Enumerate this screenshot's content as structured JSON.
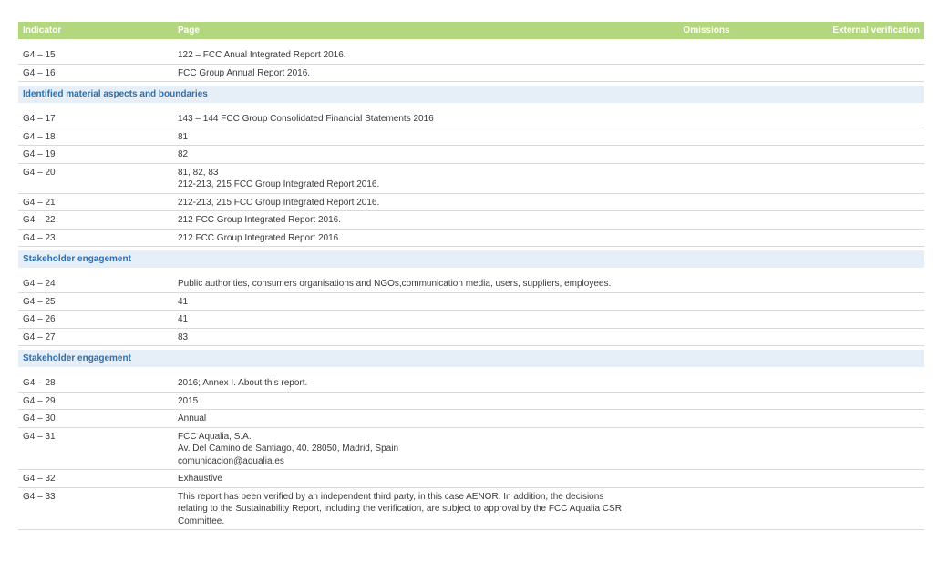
{
  "table": {
    "headers": {
      "indicator": "Indicator",
      "page": "Page",
      "omissions": "Omissions",
      "external_verification": "External verification"
    },
    "groups": [
      {
        "section": "",
        "rows": [
          {
            "indicator": "G4 – 15",
            "page": [
              "122 – FCC Anual Integrated Report 2016."
            ]
          },
          {
            "indicator": "G4 – 16",
            "page": [
              "FCC Group Annual Report 2016."
            ]
          }
        ]
      },
      {
        "section": "Identified material aspects and boundaries",
        "rows": [
          {
            "indicator": "G4 – 17",
            "page": [
              "143 – 144 FCC Group Consolidated Financial Statements 2016"
            ]
          },
          {
            "indicator": "G4 – 18",
            "page": [
              "81"
            ]
          },
          {
            "indicator": "G4 – 19",
            "page": [
              "82"
            ]
          },
          {
            "indicator": "G4 – 20",
            "page": [
              "81, 82, 83",
              "212-213, 215 FCC Group Integrated Report 2016."
            ]
          },
          {
            "indicator": "G4 – 21",
            "page": [
              "212-213, 215 FCC Group Integrated Report 2016."
            ]
          },
          {
            "indicator": "G4 – 22",
            "page": [
              "212 FCC Group Integrated Report 2016."
            ]
          },
          {
            "indicator": "G4 – 23",
            "page": [
              "212 FCC Group Integrated Report 2016."
            ]
          }
        ]
      },
      {
        "section": "Stakeholder engagement",
        "rows": [
          {
            "indicator": "G4 – 24",
            "page": [
              "Public authorities, consumers organisations and NGOs,communication media, users, suppliers, employees."
            ]
          },
          {
            "indicator": "G4 – 25",
            "page": [
              "41"
            ]
          },
          {
            "indicator": "G4 – 26",
            "page": [
              "41"
            ]
          },
          {
            "indicator": "G4 – 27",
            "page": [
              "83"
            ]
          }
        ]
      },
      {
        "section": "Stakeholder engagement",
        "rows": [
          {
            "indicator": "G4 – 28",
            "page": [
              "2016; Annex I. About this report."
            ]
          },
          {
            "indicator": "G4 – 29",
            "page": [
              "2015"
            ]
          },
          {
            "indicator": "G4 – 30",
            "page": [
              "Annual"
            ]
          },
          {
            "indicator": "G4 – 31",
            "page": [
              "FCC Aqualia, S.A.",
              "Av. Del Camino de Santiago, 40. 28050, Madrid, Spain",
              "comunicacion@aqualia.es"
            ]
          },
          {
            "indicator": "G4 – 32",
            "page": [
              "Exhaustive"
            ]
          },
          {
            "indicator": "G4 – 33",
            "page": [
              "This report has been verified by an independent third party, in this case AENOR. In addition, the decisions",
              "relating to the Sustainability Report, including the verification, are subject to approval by the FCC Aqualia CSR",
              "Committee."
            ]
          }
        ]
      }
    ]
  },
  "colors": {
    "header_bg": "#b3d77e",
    "section_bg": "#e6eef7",
    "section_text": "#2a6fb0",
    "row_border": "#d9d9d9"
  }
}
